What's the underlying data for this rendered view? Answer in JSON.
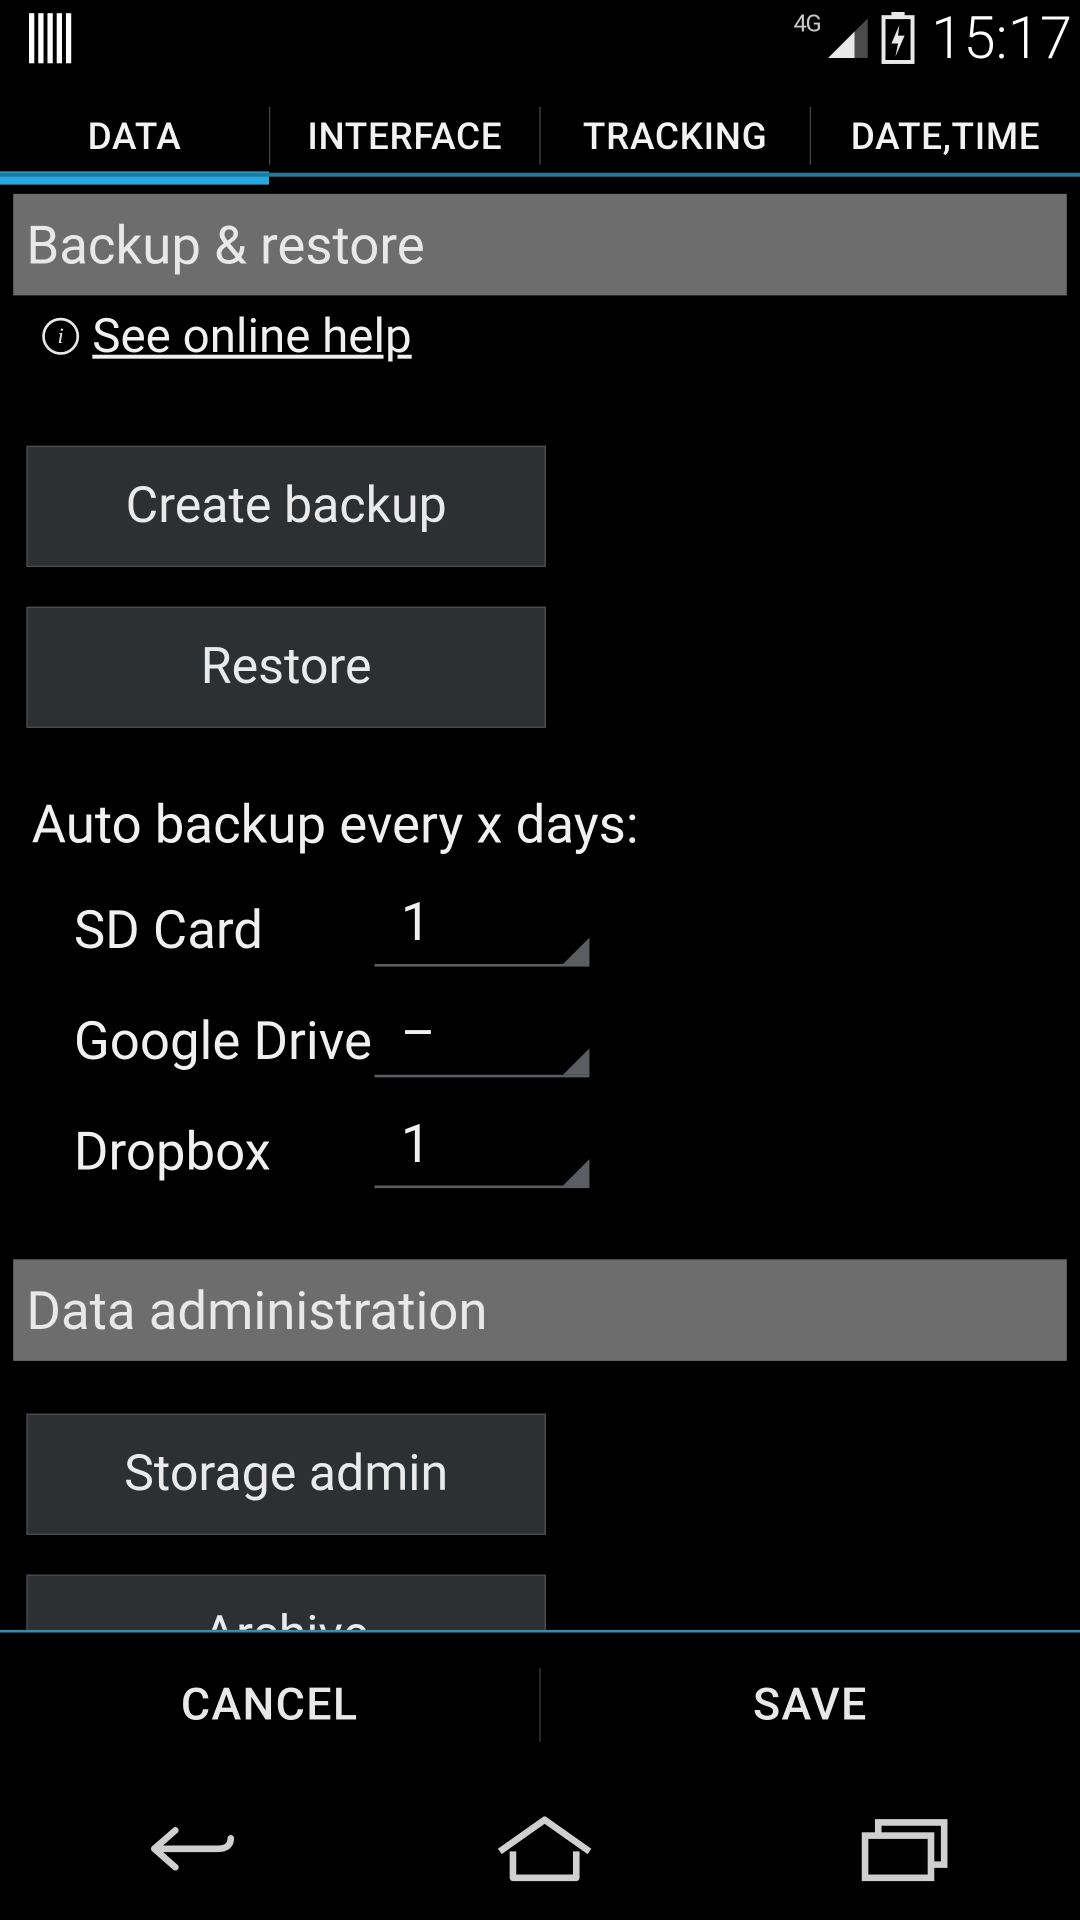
{
  "status": {
    "network_label": "4G",
    "time": "15:17"
  },
  "tabs": [
    {
      "label": "DATA",
      "active": true
    },
    {
      "label": "INTERFACE",
      "active": false
    },
    {
      "label": "TRACKING",
      "active": false
    },
    {
      "label": "DATE,TIME",
      "active": false
    }
  ],
  "backup": {
    "header": "Backup & restore",
    "help_link": "See online help",
    "create_label": "Create backup",
    "restore_label": "Restore",
    "auto_label": "Auto backup every x days:",
    "targets": [
      {
        "label": "SD Card",
        "value": "1"
      },
      {
        "label": "Google Drive",
        "value": "–"
      },
      {
        "label": "Dropbox",
        "value": "1"
      }
    ]
  },
  "data_admin": {
    "header": "Data administration",
    "storage_label": "Storage admin",
    "archive_label": "Archive"
  },
  "actions": {
    "cancel": "CANCEL",
    "save": "SAVE"
  }
}
